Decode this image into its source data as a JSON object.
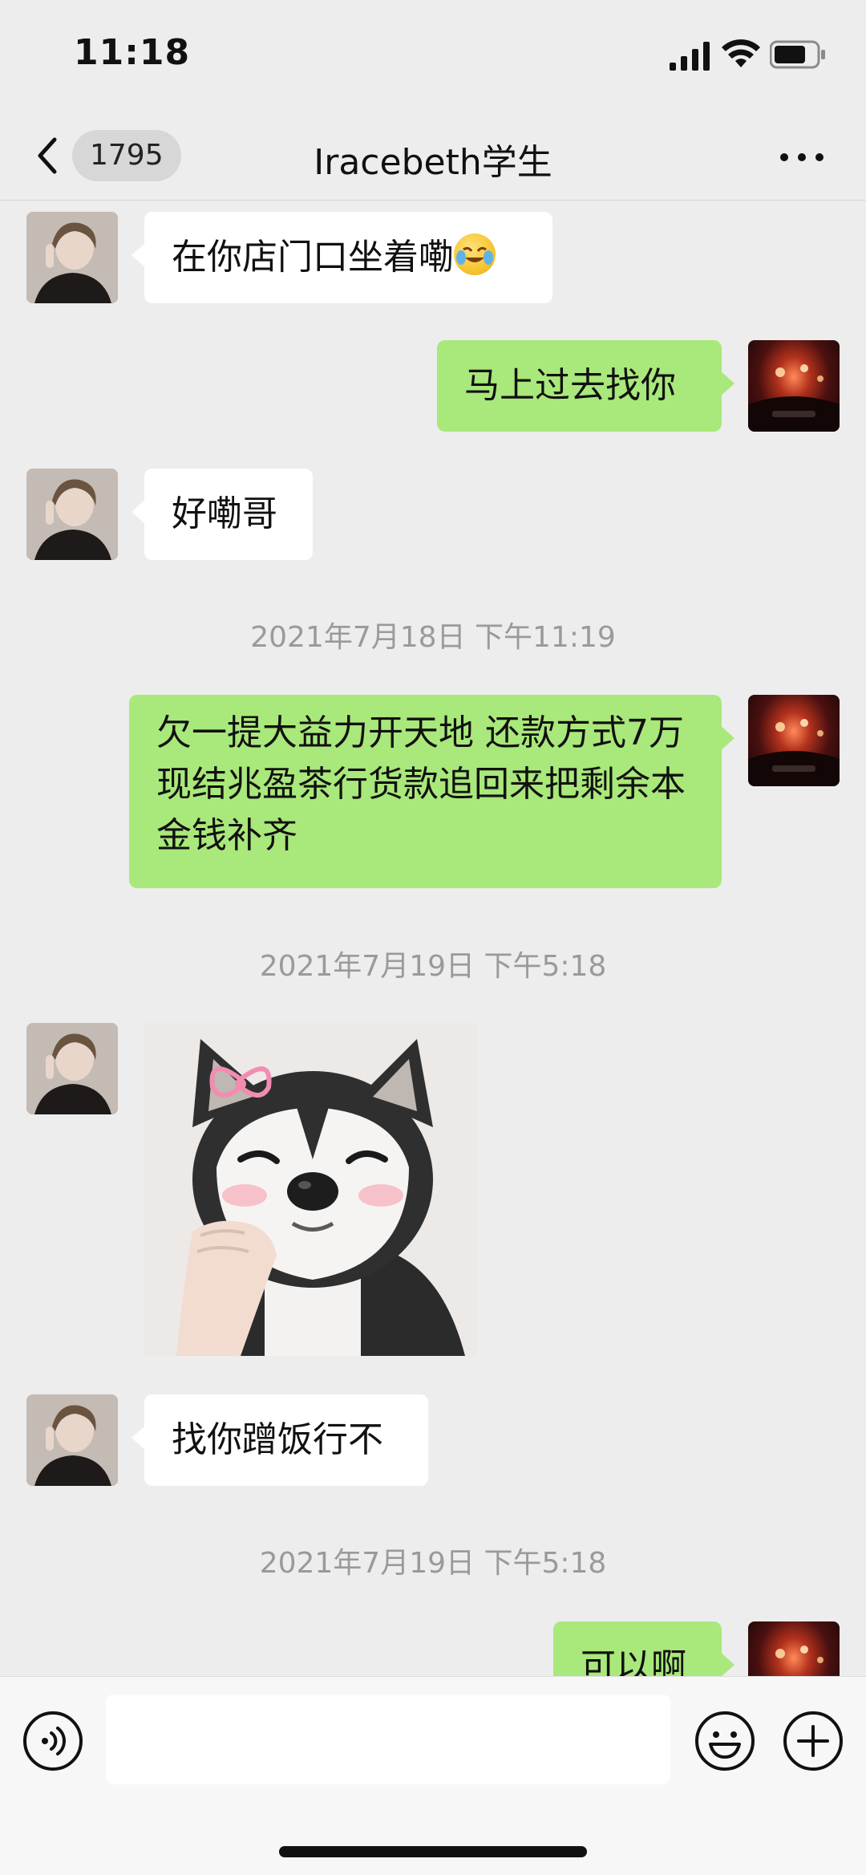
{
  "status_bar": {
    "time": "11:18"
  },
  "nav": {
    "unread_count": "1795",
    "title": "Iracebeth学生"
  },
  "messages": [
    {
      "text": "在你店门口坐着嘞"
    },
    {
      "text": "马上过去找你"
    },
    {
      "text": "好嘞哥"
    },
    {
      "text": "2021年7月18日 下午11:19"
    },
    {
      "text": "欠一提大益力开天地 还款方式7万现结兆盈茶行货款追回来把剩余本金钱补齐"
    },
    {
      "text": "2021年7月19日 下午5:18"
    },
    {
      "text": "找你蹭饭行不"
    },
    {
      "text": "2021年7月19日 下午5:18"
    },
    {
      "text": "可以啊"
    }
  ],
  "icons": {
    "back": "chevron-left-icon",
    "more": "ellipsis-icon",
    "voice": "voice-icon",
    "emoji": "emoji-icon",
    "plus": "plus-icon"
  },
  "colors": {
    "background": "#ededed",
    "bubble_self": "#a9e87a",
    "bubble_friend": "#ffffff",
    "timestamp": "#9a9a9a"
  }
}
